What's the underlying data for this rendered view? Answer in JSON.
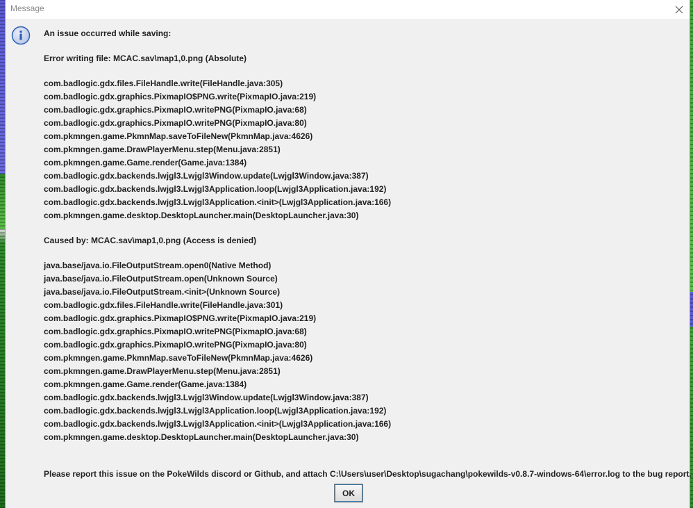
{
  "window": {
    "title": "Message"
  },
  "icons": {
    "info": "info-icon",
    "close": "close-icon"
  },
  "message": {
    "heading": "An issue occurred while saving:",
    "error_line": "Error writing file: MCAC.sav\\map1,0.png (Absolute)",
    "stack_trace_1": [
      "com.badlogic.gdx.files.FileHandle.write(FileHandle.java:305)",
      "com.badlogic.gdx.graphics.PixmapIO$PNG.write(PixmapIO.java:219)",
      "com.badlogic.gdx.graphics.PixmapIO.writePNG(PixmapIO.java:68)",
      "com.badlogic.gdx.graphics.PixmapIO.writePNG(PixmapIO.java:80)",
      "com.pkmngen.game.PkmnMap.saveToFileNew(PkmnMap.java:4626)",
      "com.pkmngen.game.DrawPlayerMenu.step(Menu.java:2851)",
      "com.pkmngen.game.Game.render(Game.java:1384)",
      "com.badlogic.gdx.backends.lwjgl3.Lwjgl3Window.update(Lwjgl3Window.java:387)",
      "com.badlogic.gdx.backends.lwjgl3.Lwjgl3Application.loop(Lwjgl3Application.java:192)",
      "com.badlogic.gdx.backends.lwjgl3.Lwjgl3Application.<init>(Lwjgl3Application.java:166)",
      "com.pkmngen.game.desktop.DesktopLauncher.main(DesktopLauncher.java:30)"
    ],
    "caused_by": "Caused by: MCAC.sav\\map1,0.png (Access is denied)",
    "stack_trace_2": [
      "java.base/java.io.FileOutputStream.open0(Native Method)",
      "java.base/java.io.FileOutputStream.open(Unknown Source)",
      "java.base/java.io.FileOutputStream.<init>(Unknown Source)",
      "com.badlogic.gdx.files.FileHandle.write(FileHandle.java:301)",
      "com.badlogic.gdx.graphics.PixmapIO$PNG.write(PixmapIO.java:219)",
      "com.badlogic.gdx.graphics.PixmapIO.writePNG(PixmapIO.java:68)",
      "com.badlogic.gdx.graphics.PixmapIO.writePNG(PixmapIO.java:80)",
      "com.pkmngen.game.PkmnMap.saveToFileNew(PkmnMap.java:4626)",
      "com.pkmngen.game.DrawPlayerMenu.step(Menu.java:2851)",
      "com.pkmngen.game.Game.render(Game.java:1384)",
      "com.badlogic.gdx.backends.lwjgl3.Lwjgl3Window.update(Lwjgl3Window.java:387)",
      "com.badlogic.gdx.backends.lwjgl3.Lwjgl3Application.loop(Lwjgl3Application.java:192)",
      "com.badlogic.gdx.backends.lwjgl3.Lwjgl3Application.<init>(Lwjgl3Application.java:166)",
      "com.pkmngen.game.desktop.DesktopLauncher.main(DesktopLauncher.java:30)"
    ],
    "report_note": "Please report this issue on the PokeWilds discord or Github, and attach C:\\Users\\user\\Desktop\\sugachang\\pokewilds-v0.8.7-windows-64\\error.log to the bug report."
  },
  "buttons": {
    "ok": "OK"
  },
  "colors": {
    "dialog_bg": "#f0f0f0",
    "titlebar_bg": "#ffffff",
    "icon_blue": "#2f5fb3",
    "button_border": "#3c7fb1"
  }
}
